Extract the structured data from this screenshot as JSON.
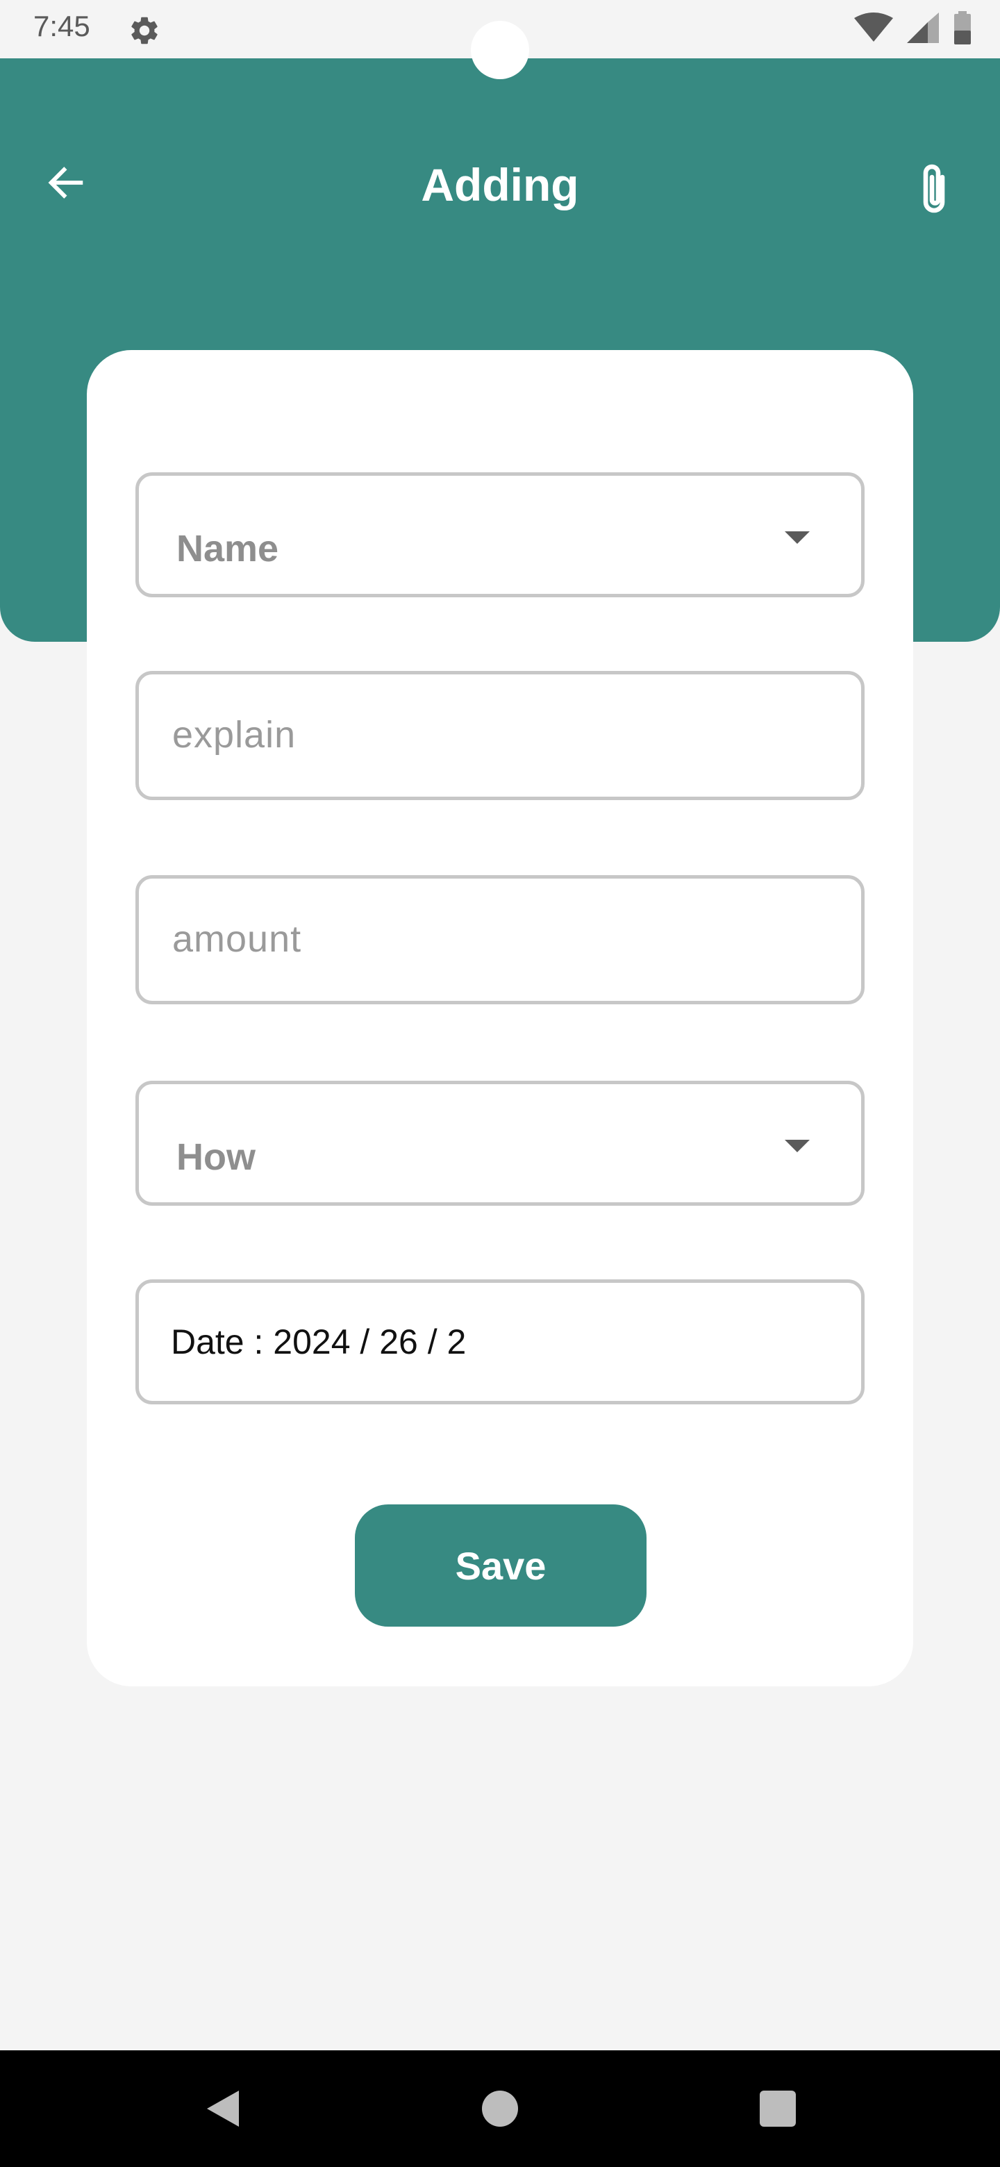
{
  "status_bar": {
    "time": "7:45"
  },
  "header": {
    "title": "Adding"
  },
  "form": {
    "name_dropdown": {
      "label": "Name"
    },
    "explain_input": {
      "placeholder": "explain"
    },
    "amount_input": {
      "placeholder": "amount"
    },
    "how_dropdown": {
      "label": "How"
    },
    "date_field": {
      "value": "Date : 2024 / 26 / 2"
    },
    "save_label": "Save"
  },
  "colors": {
    "primary": "#378a82",
    "background": "#f4f4f4",
    "card": "#ffffff",
    "field_border": "#c7c7c7",
    "placeholder": "#9a9a9a"
  },
  "icons": {
    "status_settings": "gear-icon",
    "status_wifi": "wifi-icon",
    "status_signal": "signal-icon",
    "status_battery": "battery-icon",
    "back": "arrow-left-icon",
    "attach": "paperclip-icon",
    "dropdown": "caret-down-icon",
    "nav_back": "triangle-back-icon",
    "nav_home": "circle-home-icon",
    "nav_recents": "square-recents-icon"
  }
}
